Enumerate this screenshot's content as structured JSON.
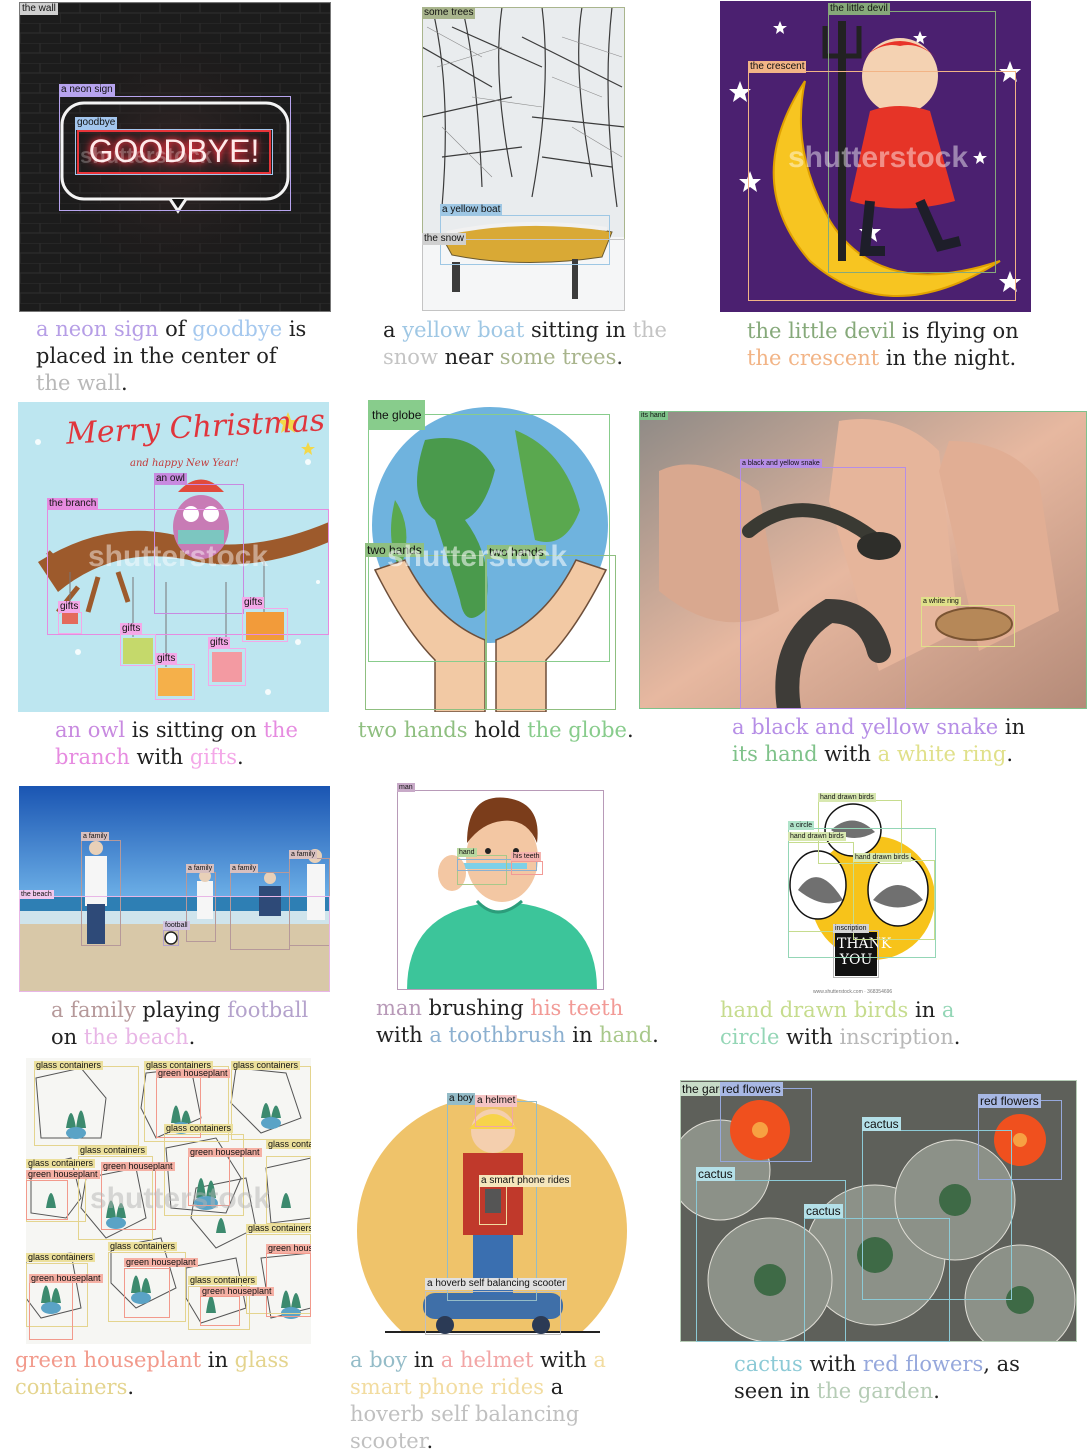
{
  "watermark": "shutterstock",
  "panels": {
    "p1": {
      "labels": {
        "wall": "the wall",
        "neon": "a neon sign",
        "goodbye": "goodbye"
      },
      "sign_text": "GOODBYE!",
      "caption": [
        {
          "t": "a neon sign",
          "c": "#b69ee6"
        },
        {
          "t": " of ",
          "c": "#222"
        },
        {
          "t": "goodbye",
          "c": "#a5c8ee"
        },
        {
          "t": " is placed in the center of ",
          "c": "#222"
        },
        {
          "t": "the wall",
          "c": "#b8b8b8"
        },
        {
          "t": ".",
          "c": "#222"
        }
      ]
    },
    "p2": {
      "labels": {
        "trees": "some trees",
        "boat": "a yellow boat",
        "snow": "the snow"
      },
      "caption": [
        {
          "t": "a ",
          "c": "#222"
        },
        {
          "t": "yellow boat",
          "c": "#9fc7e4"
        },
        {
          "t": " sitting in ",
          "c": "#222"
        },
        {
          "t": "the snow",
          "c": "#c4c4c4"
        },
        {
          "t": " near ",
          "c": "#222"
        },
        {
          "t": "some trees",
          "c": "#a8b48c"
        },
        {
          "t": ".",
          "c": "#222"
        }
      ]
    },
    "p3": {
      "labels": {
        "devil": "the little devil",
        "crescent": "the crescent"
      },
      "caption": [
        {
          "t": "the little devil",
          "c": "#86a97a"
        },
        {
          "t": " is flying on ",
          "c": "#222"
        },
        {
          "t": "the crescent",
          "c": "#f2b486"
        },
        {
          "t": " in the night.",
          "c": "#222"
        }
      ]
    },
    "p4": {
      "labels": {
        "owl": "an owl",
        "branch": "the branch",
        "gifts": "gifts"
      },
      "title1": "Merry Christmas",
      "title2": "and happy New Year!",
      "caption": [
        {
          "t": "an owl",
          "c": "#c88ae0"
        },
        {
          "t": " is sitting on ",
          "c": "#222"
        },
        {
          "t": "the branch",
          "c": "#e68be0"
        },
        {
          "t": " with ",
          "c": "#222"
        },
        {
          "t": "gifts",
          "c": "#f4a8e8"
        },
        {
          "t": ".",
          "c": "#222"
        }
      ]
    },
    "p5": {
      "labels": {
        "globe": "the globe",
        "hands": "two hands"
      },
      "caption": [
        {
          "t": "two hands",
          "c": "#8fbf80"
        },
        {
          "t": " hold ",
          "c": "#222"
        },
        {
          "t": "the globe",
          "c": "#88cc8c"
        },
        {
          "t": ".",
          "c": "#222"
        }
      ]
    },
    "p6": {
      "labels": {
        "hand": "its hand",
        "snake": "a black and yellow snake",
        "ring": "a white ring"
      },
      "caption": [
        {
          "t": "a black and yellow snake",
          "c": "#b68ee6"
        },
        {
          "t": " in ",
          "c": "#222"
        },
        {
          "t": "its hand",
          "c": "#7fc28a"
        },
        {
          "t": " with ",
          "c": "#222"
        },
        {
          "t": "a white ring",
          "c": "#e0e08a"
        },
        {
          "t": ".",
          "c": "#222"
        }
      ]
    },
    "p7": {
      "labels": {
        "family": "a family",
        "beach": "the beach",
        "football": "football"
      },
      "caption": [
        {
          "t": "a family",
          "c": "#b6999a"
        },
        {
          "t": " playing ",
          "c": "#222"
        },
        {
          "t": "football",
          "c": "#b4a2cc"
        },
        {
          "t": " on ",
          "c": "#222"
        },
        {
          "t": "the beach",
          "c": "#e8b6e6"
        },
        {
          "t": ".",
          "c": "#222"
        }
      ]
    },
    "p8": {
      "labels": {
        "man": "man",
        "hand": "hand",
        "teeth": "his teeth",
        "brush": "a toothbrush"
      },
      "caption": [
        {
          "t": "man",
          "c": "#b89ab8"
        },
        {
          "t": " brushing ",
          "c": "#222"
        },
        {
          "t": "his teeth",
          "c": "#f29a96"
        },
        {
          "t": " with ",
          "c": "#222"
        },
        {
          "t": "a toothbrush",
          "c": "#8cb0d0"
        },
        {
          "t": " in ",
          "c": "#222"
        },
        {
          "t": "hand",
          "c": "#a8c88a"
        },
        {
          "t": ".",
          "c": "#222"
        }
      ]
    },
    "p9": {
      "labels": {
        "birds": "hand drawn birds",
        "circle": "a circle",
        "inscription": "inscription"
      },
      "card": "THANK YOU",
      "url": "www.shutterstock.com · 368354696",
      "caption": [
        {
          "t": "hand drawn birds",
          "c": "#c6dc8e"
        },
        {
          "t": " in ",
          "c": "#222"
        },
        {
          "t": "a circle",
          "c": "#94d6b6"
        },
        {
          "t": " with ",
          "c": "#222"
        },
        {
          "t": "inscription",
          "c": "#b8b8b8"
        },
        {
          "t": ".",
          "c": "#222"
        }
      ]
    },
    "p10": {
      "labels": {
        "glass": "glass containers",
        "plant": "green houseplant"
      },
      "caption": [
        {
          "t": "green houseplant",
          "c": "#f29a8c"
        },
        {
          "t": " in ",
          "c": "#222"
        },
        {
          "t": "glass containers",
          "c": "#e4d48e"
        },
        {
          "t": ".",
          "c": "#222"
        }
      ]
    },
    "p11": {
      "labels": {
        "boy": "a boy",
        "helmet": "a helmet",
        "phone": "a smart phone rides",
        "scooter": "a hoverb self balancing scooter"
      },
      "caption": [
        {
          "t": "a boy",
          "c": "#94bcc8"
        },
        {
          "t": " in ",
          "c": "#222"
        },
        {
          "t": "a helmet",
          "c": "#f2a6a6"
        },
        {
          "t": " with ",
          "c": "#222"
        },
        {
          "t": "a smart phone rides",
          "c": "#f2dca0"
        },
        {
          "t": " a ",
          "c": "#222"
        },
        {
          "t": "hoverb self balancing scooter",
          "c": "#c0c0c0"
        },
        {
          "t": ".",
          "c": "#222"
        }
      ]
    },
    "p12": {
      "labels": {
        "garden": "the garden",
        "flowers": "red flowers",
        "cactus": "cactus"
      },
      "caption": [
        {
          "t": "cactus",
          "c": "#8ccad6"
        },
        {
          "t": " with ",
          "c": "#222"
        },
        {
          "t": "red flowers",
          "c": "#96a8dc"
        },
        {
          "t": ", as seen in ",
          "c": "#222"
        },
        {
          "t": "the garden",
          "c": "#b6ccb6"
        },
        {
          "t": ".",
          "c": "#222"
        }
      ]
    }
  }
}
